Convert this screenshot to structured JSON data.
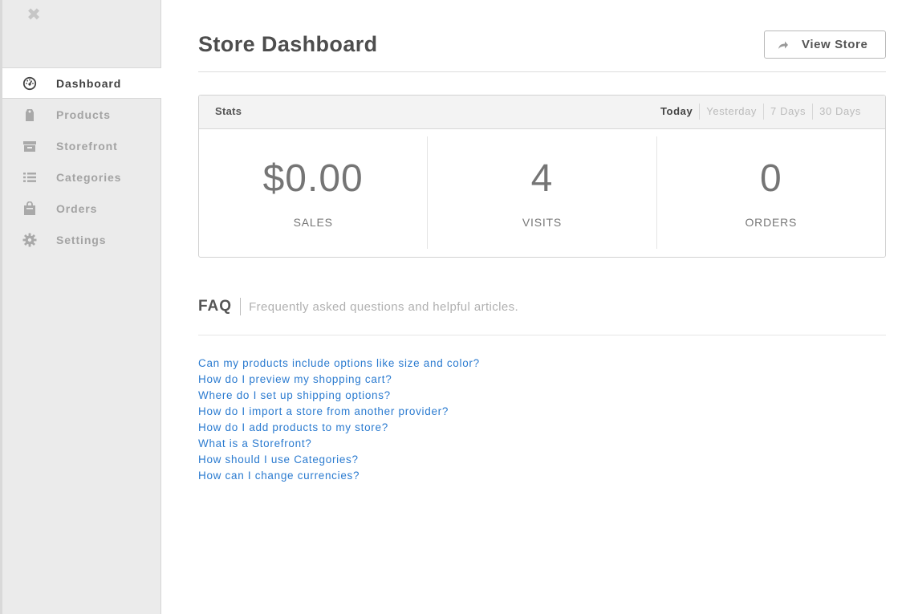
{
  "sidebar": {
    "close_icon": "close-icon",
    "items": [
      {
        "label": "Dashboard",
        "icon": "dashboard-gauge-icon",
        "active": true
      },
      {
        "label": "Products",
        "icon": "tag-icon",
        "active": false
      },
      {
        "label": "Storefront",
        "icon": "storefront-icon",
        "active": false
      },
      {
        "label": "Categories",
        "icon": "list-icon",
        "active": false
      },
      {
        "label": "Orders",
        "icon": "shopping-bag-icon",
        "active": false
      },
      {
        "label": "Settings",
        "icon": "gear-icon",
        "active": false
      }
    ]
  },
  "header": {
    "title": "Store Dashboard",
    "view_store_label": "View Store",
    "view_store_icon": "share-arrow-icon"
  },
  "stats": {
    "title": "Stats",
    "ranges": [
      {
        "label": "Today",
        "active": true
      },
      {
        "label": "Yesterday",
        "active": false
      },
      {
        "label": "7 Days",
        "active": false
      },
      {
        "label": "30 Days",
        "active": false
      }
    ],
    "metrics": [
      {
        "value": "$0.00",
        "label": "SALES"
      },
      {
        "value": "4",
        "label": "VISITS"
      },
      {
        "value": "0",
        "label": "ORDERS"
      }
    ]
  },
  "faq": {
    "title": "FAQ",
    "subtitle": "Frequently asked questions and helpful articles.",
    "links": [
      "Can my products include options like size and color?",
      "How do I preview my shopping cart?",
      "Where do I set up shipping options?",
      "How do I import a store from another provider?",
      "How do I add products to my store?",
      "What is a Storefront?",
      "How should I use Categories?",
      "How can I change currencies?"
    ]
  },
  "colors": {
    "sidebar_bg": "#ebebeb",
    "link": "#2b7bd0",
    "active_text": "#3f3f3f",
    "inactive_text": "#a3a3a3"
  }
}
